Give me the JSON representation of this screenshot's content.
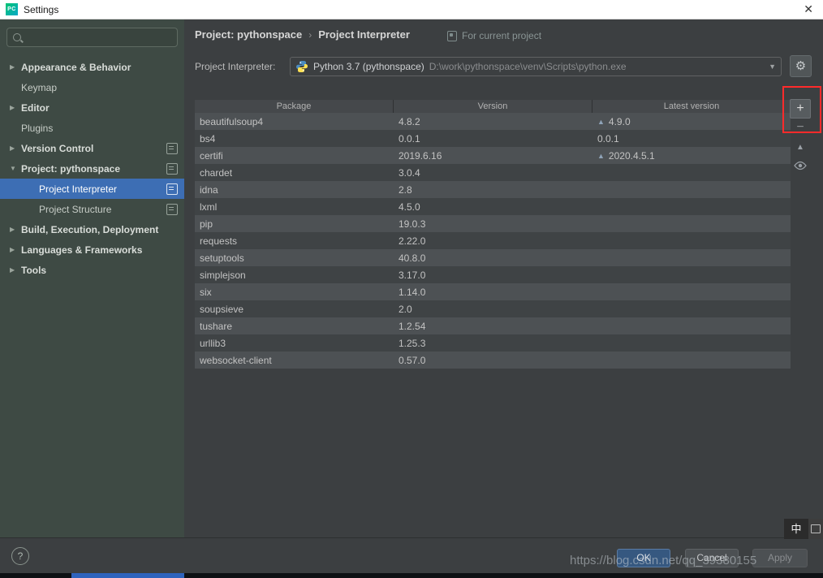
{
  "window": {
    "title": "Settings"
  },
  "icons": {
    "app": "PC",
    "close": "✕",
    "gear": "⚙",
    "caret": "▼",
    "chevron": "›",
    "add": "+",
    "remove": "−",
    "upgrade": "▲",
    "help": "?",
    "tree_collapsed": "▶",
    "tree_expanded": "▼"
  },
  "sidebar": {
    "search_placeholder": "",
    "items": [
      {
        "label": "Appearance & Behavior",
        "level": 0,
        "expandable": true,
        "expanded": false,
        "bold": true,
        "badge": false,
        "selected": false
      },
      {
        "label": "Keymap",
        "level": 0,
        "expandable": false,
        "expanded": false,
        "bold": false,
        "badge": false,
        "selected": false
      },
      {
        "label": "Editor",
        "level": 0,
        "expandable": true,
        "expanded": false,
        "bold": true,
        "badge": false,
        "selected": false
      },
      {
        "label": "Plugins",
        "level": 0,
        "expandable": false,
        "expanded": false,
        "bold": false,
        "badge": false,
        "selected": false
      },
      {
        "label": "Version Control",
        "level": 0,
        "expandable": true,
        "expanded": false,
        "bold": true,
        "badge": true,
        "selected": false
      },
      {
        "label": "Project: pythonspace",
        "level": 0,
        "expandable": true,
        "expanded": true,
        "bold": true,
        "badge": true,
        "selected": false
      },
      {
        "label": "Project Interpreter",
        "level": 1,
        "expandable": false,
        "expanded": false,
        "bold": false,
        "badge": true,
        "selected": true
      },
      {
        "label": "Project Structure",
        "level": 1,
        "expandable": false,
        "expanded": false,
        "bold": false,
        "badge": true,
        "selected": false
      },
      {
        "label": "Build, Execution, Deployment",
        "level": 0,
        "expandable": true,
        "expanded": false,
        "bold": true,
        "badge": false,
        "selected": false
      },
      {
        "label": "Languages & Frameworks",
        "level": 0,
        "expandable": true,
        "expanded": false,
        "bold": true,
        "badge": false,
        "selected": false
      },
      {
        "label": "Tools",
        "level": 0,
        "expandable": true,
        "expanded": false,
        "bold": true,
        "badge": false,
        "selected": false
      }
    ]
  },
  "header": {
    "breadcrumb": [
      "Project: pythonspace",
      "Project Interpreter"
    ],
    "for_current_project": "For current project"
  },
  "interpreter": {
    "label": "Project Interpreter:",
    "value": "Python 3.7 (pythonspace)",
    "path": "D:\\work\\pythonspace\\venv\\Scripts\\python.exe"
  },
  "table": {
    "columns": [
      "Package",
      "Version",
      "Latest version"
    ],
    "rows": [
      {
        "package": "beautifulsoup4",
        "version": "4.8.2",
        "latest": "4.9.0",
        "upgrade": true
      },
      {
        "package": "bs4",
        "version": "0.0.1",
        "latest": "0.0.1",
        "upgrade": false
      },
      {
        "package": "certifi",
        "version": "2019.6.16",
        "latest": "2020.4.5.1",
        "upgrade": true
      },
      {
        "package": "chardet",
        "version": "3.0.4",
        "latest": "",
        "upgrade": false
      },
      {
        "package": "idna",
        "version": "2.8",
        "latest": "",
        "upgrade": false
      },
      {
        "package": "lxml",
        "version": "4.5.0",
        "latest": "",
        "upgrade": false
      },
      {
        "package": "pip",
        "version": "19.0.3",
        "latest": "",
        "upgrade": false
      },
      {
        "package": "requests",
        "version": "2.22.0",
        "latest": "",
        "upgrade": false
      },
      {
        "package": "setuptools",
        "version": "40.8.0",
        "latest": "",
        "upgrade": false
      },
      {
        "package": "simplejson",
        "version": "3.17.0",
        "latest": "",
        "upgrade": false
      },
      {
        "package": "six",
        "version": "1.14.0",
        "latest": "",
        "upgrade": false
      },
      {
        "package": "soupsieve",
        "version": "2.0",
        "latest": "",
        "upgrade": false
      },
      {
        "package": "tushare",
        "version": "1.2.54",
        "latest": "",
        "upgrade": false
      },
      {
        "package": "urllib3",
        "version": "1.25.3",
        "latest": "",
        "upgrade": false
      },
      {
        "package": "websocket-client",
        "version": "0.57.0",
        "latest": "",
        "upgrade": false
      }
    ]
  },
  "footer": {
    "ok": "OK",
    "cancel": "Cancel",
    "apply": "Apply"
  },
  "watermark": "https://blog.csdn.net/qq_39380155",
  "ime": {
    "label": "中"
  }
}
